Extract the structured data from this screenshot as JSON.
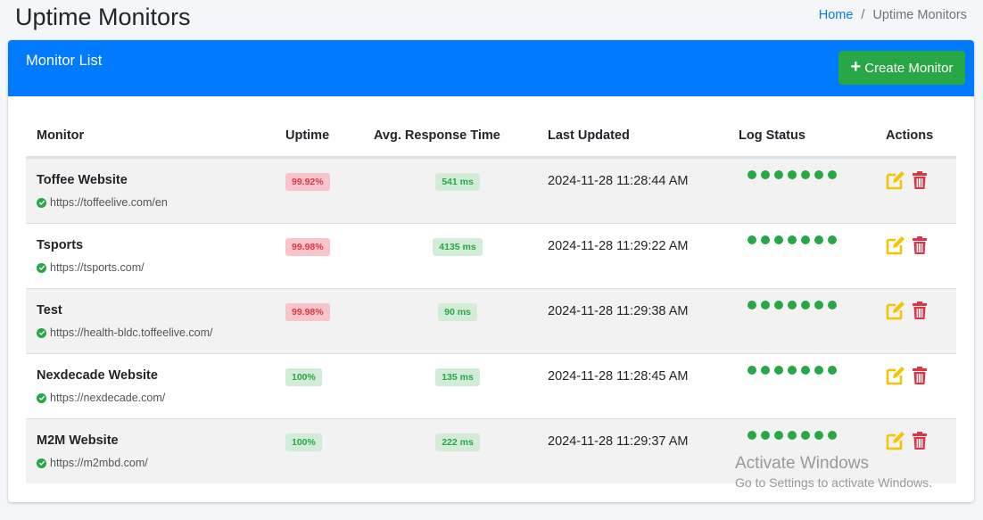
{
  "header": {
    "title": "Uptime Monitors",
    "breadcrumb": {
      "home": "Home",
      "separator": "/",
      "current": "Uptime Monitors"
    }
  },
  "card": {
    "title": "Monitor List",
    "create_button_icon": "+",
    "create_button_label": "Create Monitor"
  },
  "table": {
    "columns": [
      "Monitor",
      "Uptime",
      "Avg. Response Time",
      "Last Updated",
      "Log Status",
      "Actions"
    ],
    "rows": [
      {
        "name": "Toffee Website",
        "url": "https://toffeelive.com/en",
        "uptime": "99.92%",
        "uptime_status": "red",
        "response": "541 ms",
        "updated": "2024-11-28 11:28:44 AM",
        "log_dots": 7
      },
      {
        "name": "Tsports",
        "url": "https://tsports.com/",
        "uptime": "99.98%",
        "uptime_status": "red",
        "response": "4135 ms",
        "updated": "2024-11-28 11:29:22 AM",
        "log_dots": 7
      },
      {
        "name": "Test",
        "url": "https://health-bldc.toffeelive.com/",
        "uptime": "99.98%",
        "uptime_status": "red",
        "response": "90 ms",
        "updated": "2024-11-28 11:29:38 AM",
        "log_dots": 7
      },
      {
        "name": "Nexdecade Website",
        "url": "https://nexdecade.com/",
        "uptime": "100%",
        "uptime_status": "green",
        "response": "135 ms",
        "updated": "2024-11-28 11:28:45 AM",
        "log_dots": 7
      },
      {
        "name": "M2M Website",
        "url": "https://m2mbd.com/",
        "uptime": "100%",
        "uptime_status": "green",
        "response": "222 ms",
        "updated": "2024-11-28 11:29:37 AM",
        "log_dots": 7
      }
    ]
  },
  "watermark": {
    "title": "Activate Windows",
    "subtitle": "Go to Settings to activate Windows."
  },
  "colors": {
    "primary": "#007bff",
    "success": "#28a745",
    "danger": "#dc3545",
    "warning": "#f5c400"
  }
}
